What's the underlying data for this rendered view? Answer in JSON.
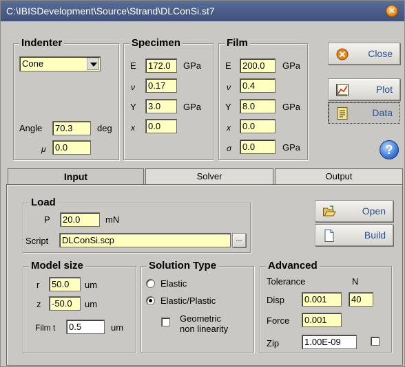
{
  "window": {
    "title": "C:\\IBISDevelopment\\Source\\Strand\\DLConSi.st7"
  },
  "indenter": {
    "legend": "Indenter",
    "shape": "Cone",
    "angle_label": "Angle",
    "angle": "70.3",
    "angle_unit": "deg",
    "mu_label": "μ",
    "mu": "0.0"
  },
  "specimen": {
    "legend": "Specimen",
    "E_label": "E",
    "E": "172.0",
    "E_unit": "GPa",
    "nu_label": "ν",
    "nu": "0.17",
    "Y_label": "Y",
    "Y": "3.0",
    "Y_unit": "GPa",
    "x_label": "x",
    "x": "0.0"
  },
  "film": {
    "legend": "Film",
    "E_label": "E",
    "E": "200.0",
    "E_unit": "GPa",
    "nu_label": "ν",
    "nu": "0.4",
    "Y_label": "Y",
    "Y": "8.0",
    "Y_unit": "GPa",
    "x_label": "x",
    "x": "0.0",
    "sigma_label": "σ",
    "sigma": "0.0",
    "sigma_unit": "GPa"
  },
  "buttons": {
    "close": "Close",
    "plot": "Plot",
    "data": "Data",
    "help": "?"
  },
  "tabs": [
    {
      "label": "Input"
    },
    {
      "label": "Solver"
    },
    {
      "label": "Output"
    }
  ],
  "load": {
    "legend": "Load",
    "P_label": "P",
    "P": "20.0",
    "P_unit": "mN",
    "script_label": "Script",
    "script": "DLConSi.scp",
    "browse": "..."
  },
  "file_buttons": {
    "open": "Open",
    "build": "Build"
  },
  "model_size": {
    "legend": "Model size",
    "r_label": "r",
    "r": "50.0",
    "r_unit": "um",
    "z_label": "z",
    "z": "-50.0",
    "z_unit": "um",
    "film_label": "Film t",
    "film_t": "0.5",
    "film_unit": "um"
  },
  "solution": {
    "legend": "Solution Type",
    "elastic": "Elastic",
    "elastic_plastic": "Elastic/Plastic",
    "geometric_1": "Geometric",
    "geometric_2": "non linearity"
  },
  "advanced": {
    "legend": "Advanced",
    "tolerance_label": "Tolerance",
    "n_label": "N",
    "disp_label": "Disp",
    "disp": "0.001",
    "n": "40",
    "force_label": "Force",
    "force": "0.001",
    "zip_label": "Zip",
    "zip": "1.00E-09"
  }
}
